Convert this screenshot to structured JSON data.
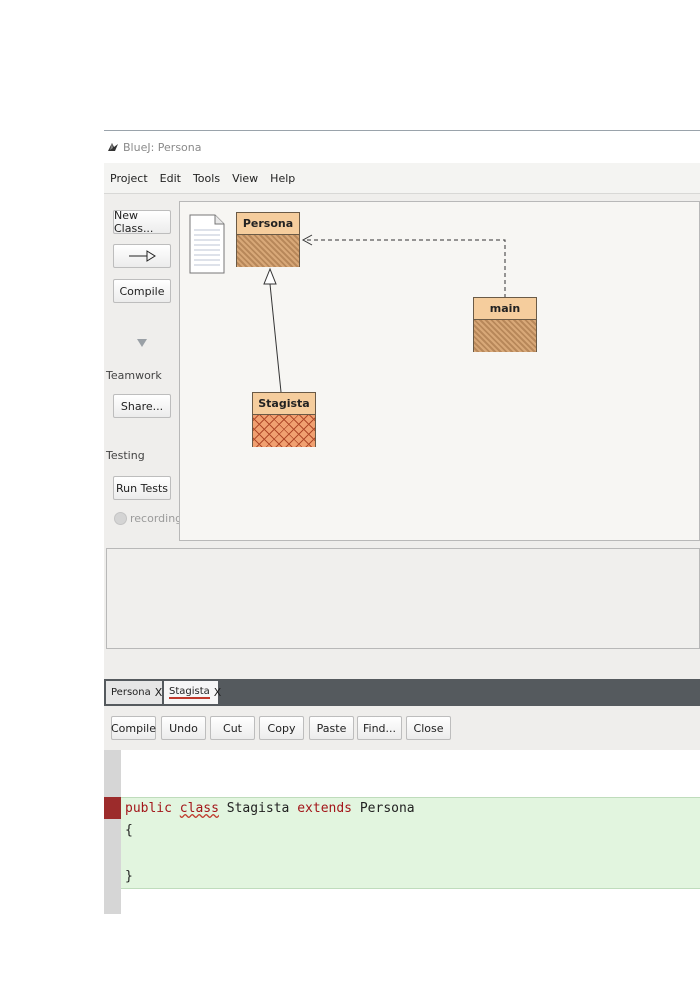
{
  "window": {
    "title": "BlueJ: Persona"
  },
  "menu": [
    "Project",
    "Edit",
    "Tools",
    "View",
    "Help"
  ],
  "sidebar": {
    "new_class": "New Class...",
    "arrow_symbol": "—▷",
    "compile": "Compile",
    "teamwork_label": "Teamwork",
    "share": "Share...",
    "testing_label": "Testing",
    "run_tests": "Run Tests",
    "recording": "recording"
  },
  "diagram": {
    "classes": [
      {
        "name": "Persona"
      },
      {
        "name": "main"
      },
      {
        "name": "Stagista"
      }
    ]
  },
  "tabs": [
    {
      "label": "Persona",
      "close": "X"
    },
    {
      "label": "Stagista",
      "close": "X"
    }
  ],
  "editor_toolbar": [
    "Compile",
    "Undo",
    "Cut",
    "Copy",
    "Paste",
    "Find...",
    "Close"
  ],
  "code": {
    "kw_public": "public",
    "kw_class": "class",
    "class_name": "Stagista",
    "kw_extends": "extends",
    "super_name": "Persona",
    "open_brace": "{",
    "close_brace": "}"
  },
  "colors": {
    "class_header": "#f5cd9d",
    "class_hatch": "#d8a878",
    "stagista_hatch": "#b04a2a",
    "error_marker": "#9c2b2b",
    "code_bg": "#e2f5df",
    "keyword": "#a3161a"
  },
  "icons": {
    "app": "bluej-bird-icon",
    "readme": "readme-document-icon",
    "expand": "triangle-down-icon",
    "record": "record-dot-icon"
  }
}
